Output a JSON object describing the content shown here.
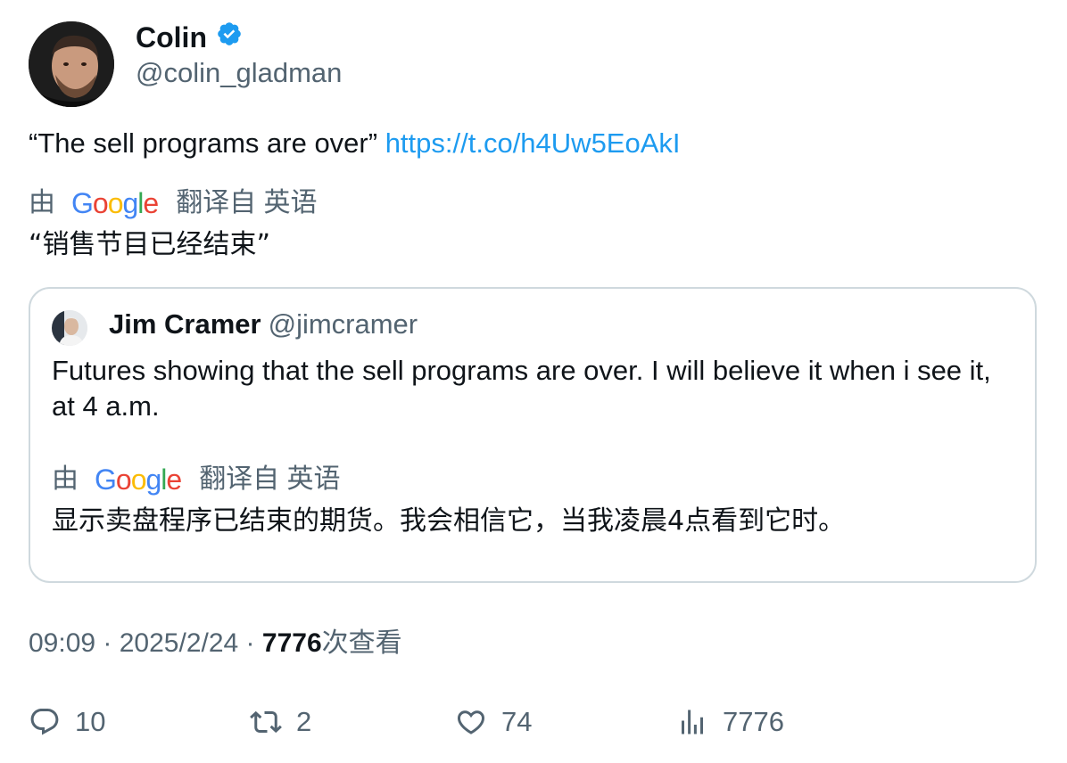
{
  "author": {
    "name": "Colin",
    "handle": "@colin_gladman",
    "verified": true
  },
  "tweet": {
    "text": "“The sell programs are over” ",
    "link": "https://t.co/h4Uw5EoAkI"
  },
  "translation": {
    "by_label": "由",
    "google": [
      "G",
      "o",
      "o",
      "g",
      "l",
      "e"
    ],
    "from_label": "翻译自 英语",
    "text": "“销售节目已经结束”"
  },
  "quote": {
    "name": "Jim Cramer",
    "handle": "@jimcramer",
    "text": "Futures showing that the sell programs are over. I will believe it when i see it, at 4 a.m.",
    "translation": {
      "by_label": "由",
      "from_label": "翻译自 英语",
      "text": "显示卖盘程序已结束的期货。我会相信它，当我凌晨4点看到它时。"
    }
  },
  "meta": {
    "time": "09:09",
    "sep1": " · ",
    "date": "2025/2/24",
    "sep2": " · ",
    "views_count": "7776",
    "views_label": "次查看"
  },
  "actions": {
    "replies": "10",
    "retweets": "2",
    "likes": "74",
    "views": "7776"
  },
  "colors": {
    "link": "#1d9bf0",
    "secondary_text": "#536471",
    "border": "#cfd9de",
    "verified": "#1d9bf0"
  }
}
